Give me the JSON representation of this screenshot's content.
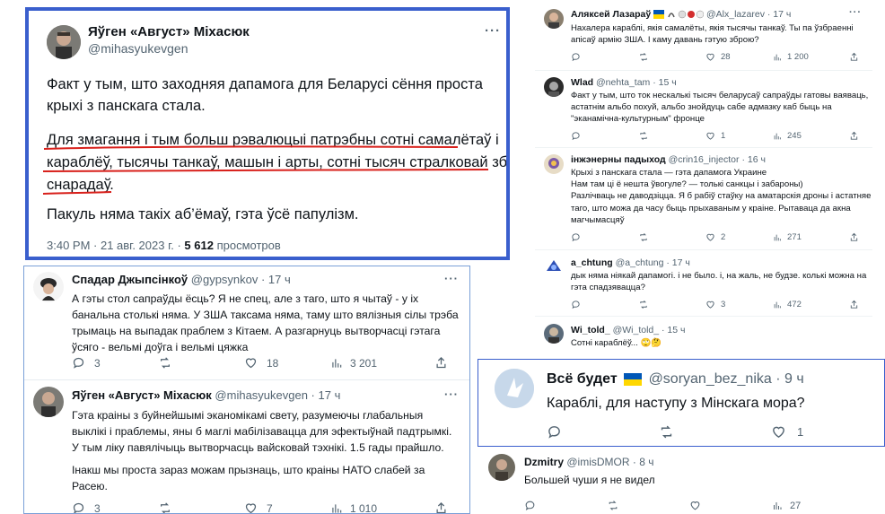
{
  "main": {
    "name": "Яўген «Август» Міхасюк",
    "handle": "@mihasyukevgen",
    "more": "···",
    "para1": "Факт у тым, што заходняя дапамога для Беларусі сёння проста крыхі з панскага стала.",
    "para2_lines": [
      "Для змагання і тым больш рэвалюцыі патрэбны сотні самалётаў і",
      "караблёў, тысячы танкаў, машын і арты, сотні тысяч стралковай зброі і",
      "снарадаў."
    ],
    "para3": "Пакуль няма такіх аб’ёмаў, гэта ўсё папулізм.",
    "time": "3:40 PM · 21 авг. 2023 г. · ",
    "views": "5 612",
    "views_label": " просмотров",
    "border_color": "#3a5fcd",
    "underline_color": "#d8201b"
  },
  "reply1": {
    "name": "Спадар Джыпсінкоў",
    "meta": "@gypsynkov · 17 ч",
    "more": "···",
    "lines": [
      "А гэты стол сапраўды ёсць? Я не спец, але з таго, што я чытаў - у іх",
      "банальна столькі няма. У ЗША таксама няма, таму што вялізныя сілы трэба",
      "трымаць на выпадак праблем з Кітаем. А разгарнуць вытворчасці гэтага",
      "ўсяго - вельмі доўга і вельмі цяжка"
    ],
    "replies": "3",
    "retweets": "",
    "likes": "18",
    "views": "3 201"
  },
  "reply2": {
    "name": "Яўген «Август» Міхасюк",
    "meta": "@mihasyukevgen · 17 ч",
    "more": "···",
    "lines": [
      "Гэта краіны з буйнейшымі эканомікамі свету, разумеючы глабальныя",
      "выклікі і  праблемы, яны б маглі мабілізавацца для эфектыўнай падтрымкі.",
      "У тым ліку павялічыць вытворчасць вайсковай тэхнікі. 1.5 гады прайшло."
    ],
    "lines2": [
      "Інакш мы проста зараз можам прызнаць, што краіны НАТО слабей за",
      "Расею."
    ],
    "replies": "3",
    "retweets": "",
    "likes": "7",
    "views": "1 010"
  },
  "right": [
    {
      "name": "Аляксей Лазараў",
      "meta": "@Alx_lazarev · 17 ч",
      "lines": [
        "Нахалера караблі, якія самалёты, якія тысячы танкаў. Ты па ўзбраенні",
        "апісаў армію ЗША. І каму давань гэтую зброю?"
      ],
      "replies": "",
      "retweets": "",
      "likes": "28",
      "views": "1 200"
    },
    {
      "name": "Wlad",
      "meta": "@nehta_tam · 15 ч",
      "lines": [
        "Факт у тым, што ток нескалькі тысяч беларусаў сапраўды гатовы ваяваць,",
        "астатнім альбо похуй, альбо знойдуць сабе адмазку каб быць на",
        "\"эканамічна-культурным\" фронце"
      ],
      "replies": "",
      "retweets": "",
      "likes": "1",
      "views": "245"
    },
    {
      "name": "інжэнерны падыход",
      "meta": "@crin16_injector · 16 ч",
      "lines": [
        "Крыхі з панскага стала — гэта дапамога Украине",
        "Нам там ці ё нешта ўвогуле? — толькі санкцы і забароны)",
        "Разлічваць не даводзіцца. Я б рабіў стаўку на аматарскія дроны і астатняе з",
        "таго, што можа да часу быць прыхаваным у краіне. Рытаваца да акна",
        "магчымасцяў"
      ],
      "replies": "",
      "retweets": "",
      "likes": "2",
      "views": "271"
    },
    {
      "name": "a_chtung",
      "meta": "@a_chtung · 17 ч",
      "lines": [
        "дык няма ніякай дапамогі. і не было. і, на жаль, не будзе. колькі можна на",
        "гэта спадзявацца?"
      ],
      "replies": "",
      "retweets": "",
      "likes": "3",
      "views": "472"
    },
    {
      "name": "Wi_told_",
      "meta": "@Wi_told_ · 15 ч",
      "lines": [
        "Сотні караблёў... 🙄🤔"
      ]
    }
  ],
  "bottom_right": {
    "name": "Всё будет",
    "meta": "@soryan_bez_nika · 9 ч",
    "text": "Караблі, для наступу з Мінскага мора?",
    "replies": "",
    "retweets": "",
    "likes": "1"
  },
  "dzmitry": {
    "name": "Dzmitry",
    "meta": "@imisDMOR · 8 ч",
    "text": "Большей чуши я не видел",
    "replies": "",
    "retweets": "",
    "likes": "",
    "views": "27"
  }
}
